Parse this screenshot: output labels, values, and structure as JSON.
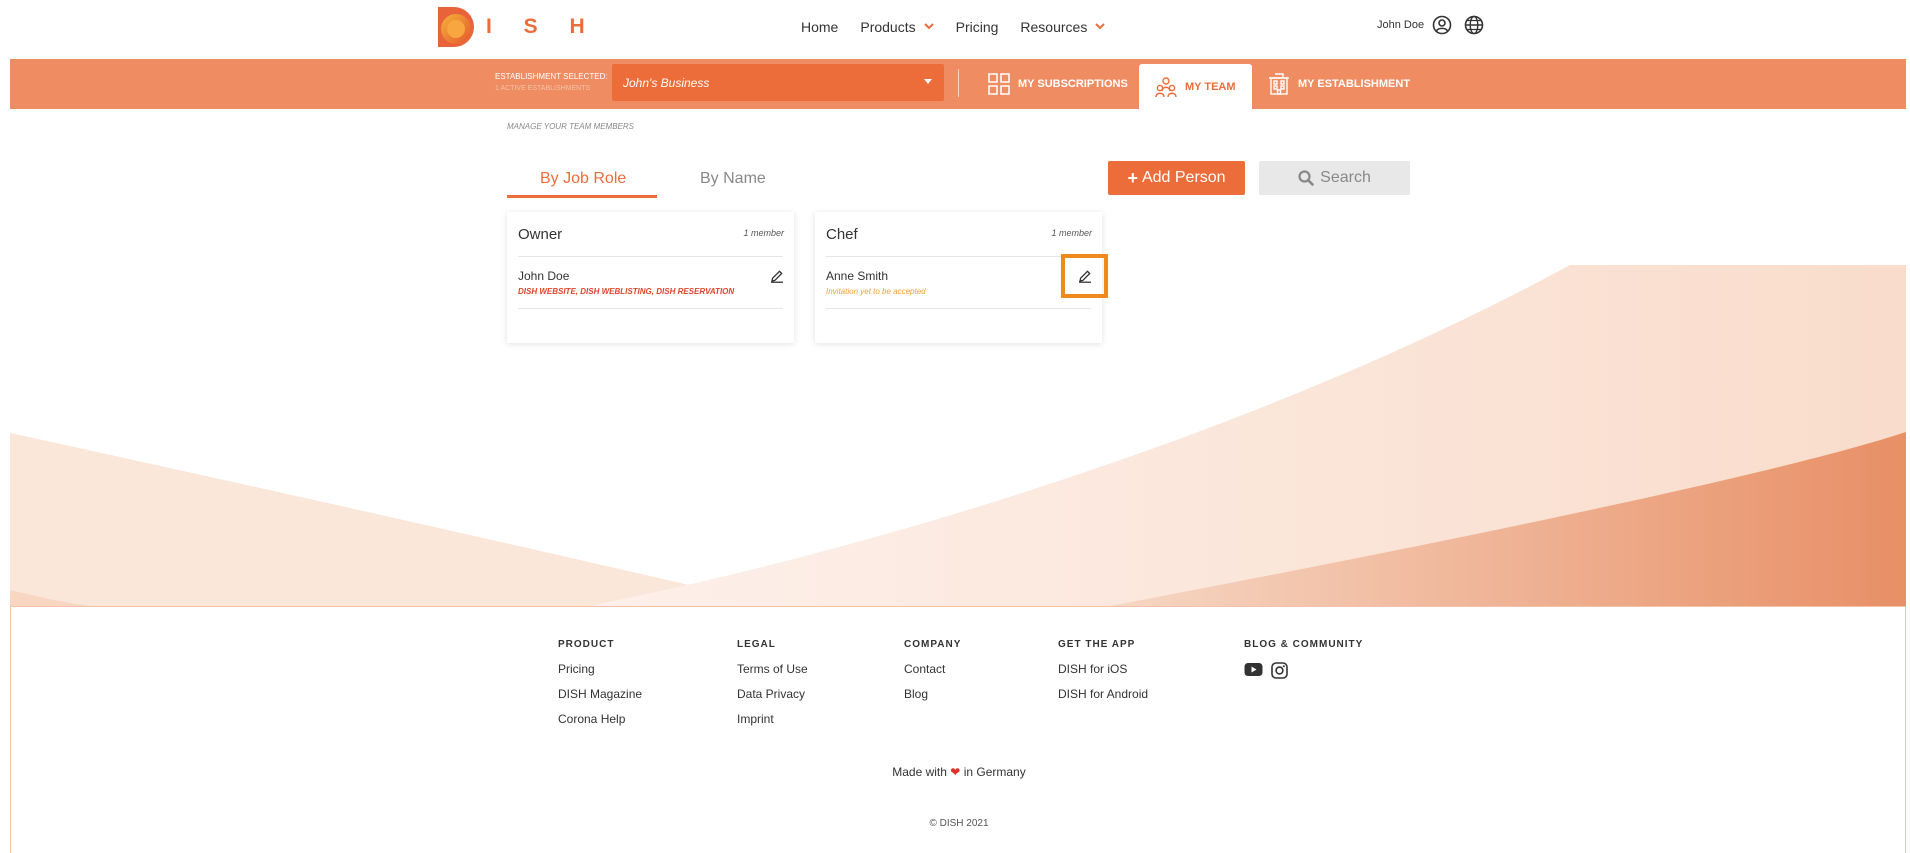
{
  "brand": {
    "name": "I S H",
    "accent": "#ec6d3a",
    "highlight": "#f08a1c"
  },
  "nav": {
    "items": [
      {
        "label": "Home",
        "has_dropdown": false
      },
      {
        "label": "Products",
        "has_dropdown": true
      },
      {
        "label": "Pricing",
        "has_dropdown": false
      },
      {
        "label": "Resources",
        "has_dropdown": true
      }
    ],
    "user_name": "John Doe"
  },
  "establishment": {
    "label": "ESTABLISHMENT SELECTED:",
    "sublabel": "1 ACTIVE ESTABLISHMENTS",
    "selected": "John's Business",
    "tabs": [
      {
        "label": "MY SUBSCRIPTIONS",
        "active": false,
        "icon": "grid-icon"
      },
      {
        "label": "MY TEAM",
        "active": true,
        "icon": "team-icon"
      },
      {
        "label": "MY ESTABLISHMENT",
        "active": false,
        "icon": "building-icon"
      }
    ]
  },
  "team": {
    "section_label": "MANAGE YOUR TEAM MEMBERS",
    "tabs": {
      "by_role": "By Job Role",
      "by_name": "By Name"
    },
    "add_button": "Add Person",
    "search_button": "Search",
    "roles": [
      {
        "title": "Owner",
        "count": "1 member",
        "members": [
          {
            "name": "John Doe",
            "sub": "DISH WEBSITE, DISH WEBLISTING, DISH RESERVATION",
            "sub_color": "#e0442a"
          }
        ]
      },
      {
        "title": "Chef",
        "count": "1 member",
        "members": [
          {
            "name": "Anne Smith",
            "sub": "Invitation yet to be accepted",
            "sub_color": "#f0a030"
          }
        ]
      }
    ]
  },
  "footer": {
    "columns": [
      {
        "heading": "PRODUCT",
        "links": [
          "Pricing",
          "DISH Magazine",
          "Corona Help"
        ]
      },
      {
        "heading": "LEGAL",
        "links": [
          "Terms of Use",
          "Data Privacy",
          "Imprint"
        ]
      },
      {
        "heading": "COMPANY",
        "links": [
          "Contact",
          "Blog"
        ]
      },
      {
        "heading": "GET THE APP",
        "links": [
          "DISH for iOS",
          "DISH for Android"
        ]
      },
      {
        "heading": "BLOG & COMMUNITY",
        "icons": [
          "youtube-icon",
          "instagram-icon"
        ]
      }
    ],
    "made_prefix": "Made with",
    "made_suffix": "in Germany",
    "copyright": "© DISH 2021"
  }
}
